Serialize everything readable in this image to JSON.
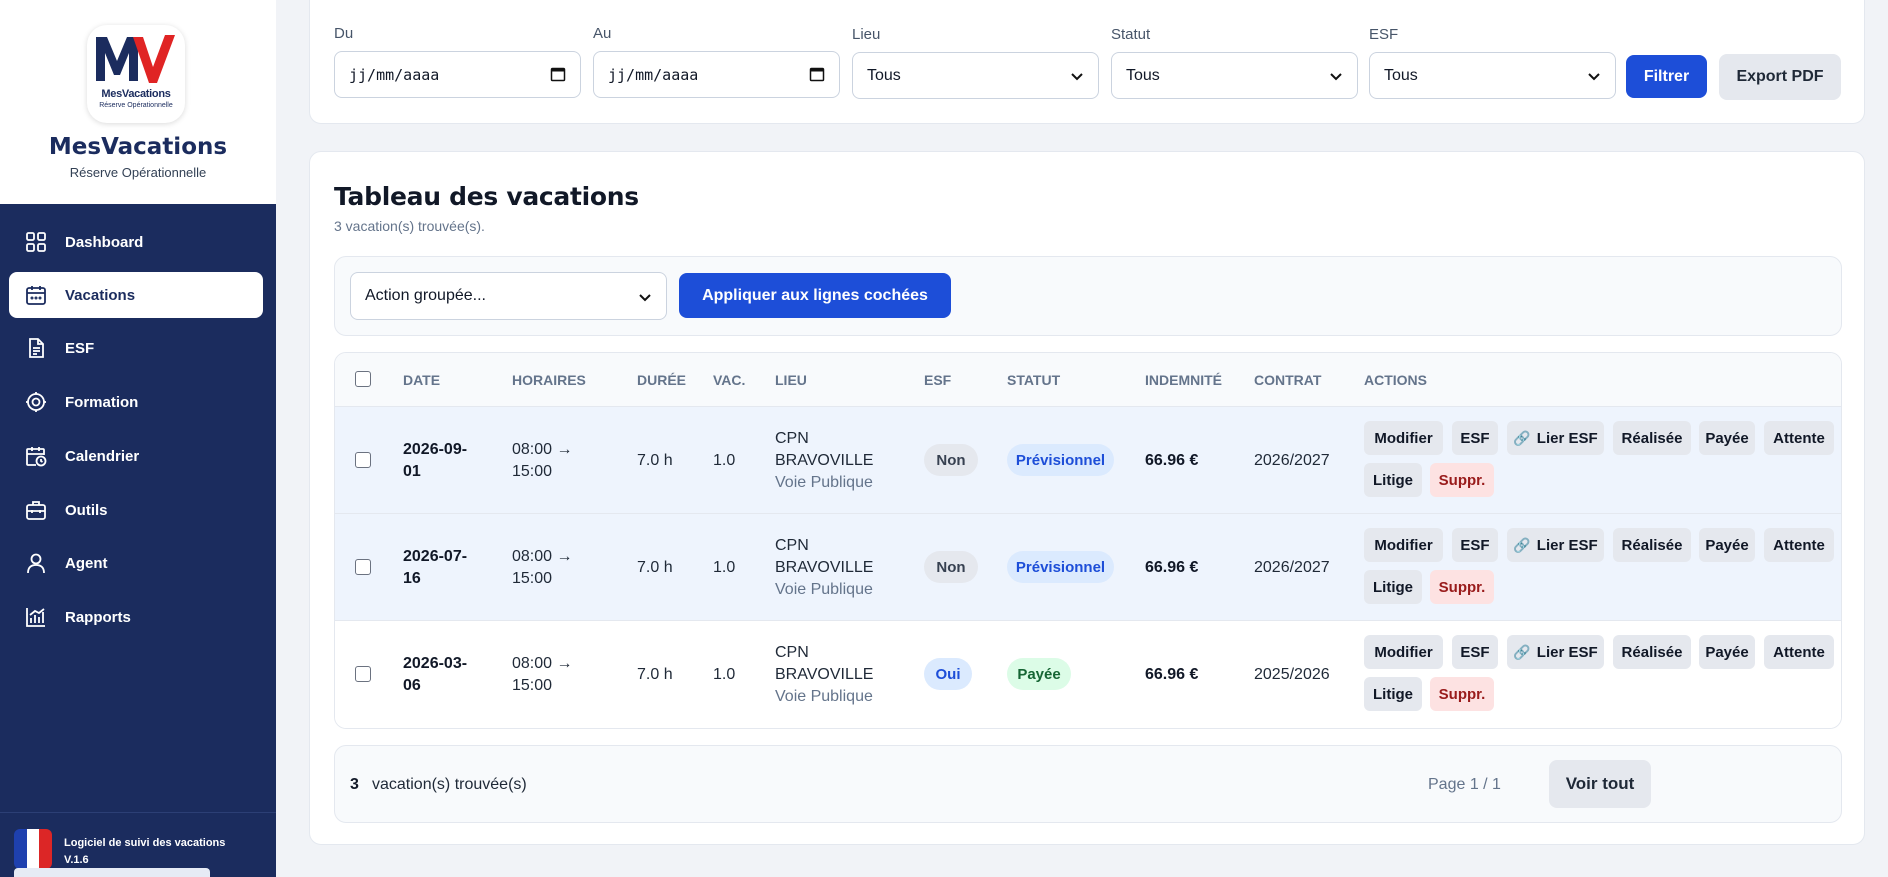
{
  "brand": {
    "logo_letters": "MV",
    "logo_line1": "MesVacations",
    "logo_line2": "Réserve Opérationnelle",
    "name": "MesVacations",
    "tagline": "Réserve Opérationnelle"
  },
  "sidebar": {
    "items": [
      {
        "label": "Dashboard",
        "icon": "dashboard-grid-icon"
      },
      {
        "label": "Vacations",
        "icon": "calendar-icon",
        "active": true
      },
      {
        "label": "ESF",
        "icon": "document-icon"
      },
      {
        "label": "Formation",
        "icon": "target-icon"
      },
      {
        "label": "Calendrier",
        "icon": "calendar-clock-icon"
      },
      {
        "label": "Outils",
        "icon": "briefcase-icon"
      },
      {
        "label": "Agent",
        "icon": "user-icon"
      },
      {
        "label": "Rapports",
        "icon": "chart-icon"
      }
    ],
    "footer_line1": "Logiciel de suivi des vacations",
    "footer_line2": "V.1.6"
  },
  "filters": {
    "from_label": "Du",
    "from_placeholder": "jj/mm/aaaa",
    "to_label": "Au",
    "to_placeholder": "jj/mm/aaaa",
    "lieu_label": "Lieu",
    "lieu_value": "Tous",
    "statut_label": "Statut",
    "statut_value": "Tous",
    "esf_label": "ESF",
    "esf_value": "Tous",
    "filter_button": "Filtrer",
    "export_button": "Export PDF"
  },
  "table_section": {
    "title": "Tableau des vacations",
    "subtitle": "3 vacation(s) trouvée(s).",
    "bulk_select": "Action groupée...",
    "apply_button": "Appliquer aux lignes cochées",
    "headers": [
      "DATE",
      "HORAIRES",
      "DURÉE",
      "VAC.",
      "LIEU",
      "ESF",
      "STATUT",
      "INDEMNITÉ",
      "CONTRAT",
      "ACTIONS"
    ],
    "rows": [
      {
        "date_line1": "2026-09-",
        "date_line2": "01",
        "hours_line1": "08:00 →",
        "hours_line2": "15:00",
        "duration": "7.0 h",
        "vac": "1.0",
        "lieu_line1": "CPN",
        "lieu_line2": "BRAVOVILLE",
        "lieu_line3": "Voie Publique",
        "esf": "Non",
        "statut": "Prévisionnel",
        "indemnite": "66.96 €",
        "contrat": "2026/2027"
      },
      {
        "date_line1": "2026-07-",
        "date_line2": "16",
        "hours_line1": "08:00 →",
        "hours_line2": "15:00",
        "duration": "7.0 h",
        "vac": "1.0",
        "lieu_line1": "CPN",
        "lieu_line2": "BRAVOVILLE",
        "lieu_line3": "Voie Publique",
        "esf": "Non",
        "statut": "Prévisionnel",
        "indemnite": "66.96 €",
        "contrat": "2026/2027"
      },
      {
        "date_line1": "2026-03-",
        "date_line2": "06",
        "hours_line1": "08:00 →",
        "hours_line2": "15:00",
        "duration": "7.0 h",
        "vac": "1.0",
        "lieu_line1": "CPN",
        "lieu_line2": "BRAVOVILLE",
        "lieu_line3": "Voie Publique",
        "esf": "Oui",
        "statut": "Payée",
        "indemnite": "66.96 €",
        "contrat": "2025/2026"
      }
    ],
    "actions": {
      "modifier": "Modifier",
      "esf": "ESF",
      "lier_esf": "Lier ESF",
      "realisee": "Réalisée",
      "payee": "Payée",
      "attente": "Attente",
      "litige": "Litige",
      "suppr": "Suppr."
    },
    "footer_count": "3",
    "footer_count_label": "vacation(s) trouvée(s)",
    "pagination": "Page 1 / 1",
    "view_all_button": "Voir tout"
  },
  "colors": {
    "sidebar_bg": "#1b2c5e",
    "primary": "#1d4ed8",
    "logo_red": "#e02424",
    "status_prev_bg": "#dbeafe",
    "status_prev_text": "#1d4ed8",
    "status_paid_bg": "#dcfce7",
    "status_paid_text": "#166534",
    "danger_bg": "#fde2e2",
    "danger_text": "#991b1b"
  }
}
